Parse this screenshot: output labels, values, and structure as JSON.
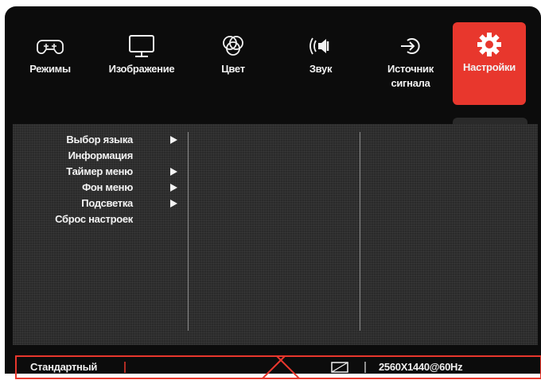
{
  "tabs": [
    {
      "label": "Режимы",
      "icon": "gamepad-icon",
      "active": false
    },
    {
      "label": "Изображение",
      "icon": "monitor-icon",
      "active": false
    },
    {
      "label": "Цвет",
      "icon": "color-circles-icon",
      "active": false
    },
    {
      "label": "Звук",
      "icon": "speaker-icon",
      "active": false
    },
    {
      "label": "Источник сигнала",
      "icon": "input-source-icon",
      "active": false
    },
    {
      "label": "Настройки",
      "icon": "gear-icon",
      "active": true
    }
  ],
  "menu": [
    {
      "label": "Выбор языка",
      "has_submenu": true
    },
    {
      "label": "Информация",
      "has_submenu": false
    },
    {
      "label": "Таймер меню",
      "has_submenu": true
    },
    {
      "label": "Фон меню",
      "has_submenu": true
    },
    {
      "label": "Подсветка",
      "has_submenu": true
    },
    {
      "label": "Сброс настроек",
      "has_submenu": false
    }
  ],
  "status_bar": {
    "mode": "Стандартный",
    "resolution": "2560X1440@60Hz",
    "aspect_icon": "aspect-ratio-icon"
  },
  "colors": {
    "accent": "#e8372d",
    "background": "#0c0c0c",
    "panel": "#2a2a2a"
  }
}
